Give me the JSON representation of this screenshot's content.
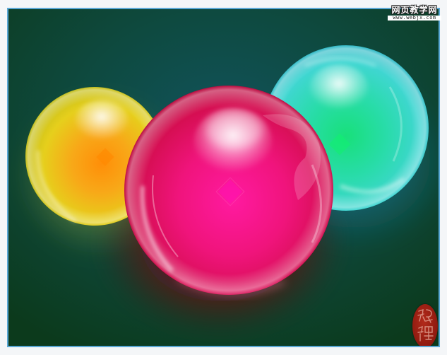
{
  "watermark": {
    "title": "网页教学网",
    "url": "www.webjx.com"
  },
  "seal": {
    "text": "貂蝉"
  },
  "colors": {
    "background_center": "#0f4a52",
    "background_edge": "#0d3d1f",
    "frame_border": "#5aa8d6",
    "sphere_yellow": "#e8d020",
    "sphere_orange_core": "#ff9a10",
    "sphere_pink": "#e8146a",
    "sphere_cyan": "#38d8d0",
    "sphere_green_core": "#20e07a",
    "seal_red": "#9e2014"
  },
  "spheres": [
    {
      "name": "yellow-orange-sphere",
      "color": "yellow"
    },
    {
      "name": "pink-red-sphere",
      "color": "pink"
    },
    {
      "name": "cyan-green-sphere",
      "color": "cyan"
    }
  ]
}
